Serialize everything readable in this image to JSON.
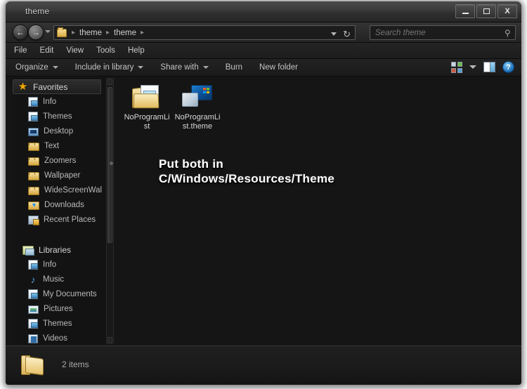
{
  "window": {
    "title": "theme",
    "controls": {
      "minimize": "minimize-button",
      "maximize": "maximize-button",
      "close_label": "X"
    }
  },
  "address_bar": {
    "back_glyph": "←",
    "forward_glyph": "→",
    "crumbs": [
      "theme",
      "theme"
    ],
    "separator": "▸",
    "refresh_glyph": "↻"
  },
  "search": {
    "placeholder": "Search theme",
    "value": "",
    "icon": "search-icon"
  },
  "menu_bar": {
    "items": [
      {
        "label": "File"
      },
      {
        "label": "Edit"
      },
      {
        "label": "View"
      },
      {
        "label": "Tools"
      },
      {
        "label": "Help"
      }
    ]
  },
  "toolbar": {
    "items": [
      {
        "label": "Organize",
        "has_caret": true
      },
      {
        "label": "Include in library",
        "has_caret": true
      },
      {
        "label": "Share with",
        "has_caret": true
      },
      {
        "label": "Burn",
        "has_caret": false
      },
      {
        "label": "New folder",
        "has_caret": false
      }
    ],
    "right_icons": [
      {
        "name": "change-view-icon"
      },
      {
        "name": "view-dropdown-icon"
      },
      {
        "name": "preview-pane-icon"
      },
      {
        "name": "help-icon",
        "glyph": "?"
      }
    ]
  },
  "sidebar": {
    "groups": [
      {
        "header": {
          "label": "Favorites",
          "icon": "star-icon"
        },
        "items": [
          {
            "label": "Info",
            "icon": "document-icon"
          },
          {
            "label": "Themes",
            "icon": "document-icon"
          },
          {
            "label": "Desktop",
            "icon": "desktop-icon"
          },
          {
            "label": "Text",
            "icon": "folder-icon"
          },
          {
            "label": "Zoomers",
            "icon": "folder-icon"
          },
          {
            "label": "Wallpaper",
            "icon": "folder-icon"
          },
          {
            "label": "WideScreenWal",
            "icon": "folder-icon"
          },
          {
            "label": "Downloads",
            "icon": "downloads-icon"
          },
          {
            "label": "Recent Places",
            "icon": "recent-places-icon"
          }
        ]
      },
      {
        "header": {
          "label": "Libraries",
          "icon": "libraries-icon"
        },
        "items": [
          {
            "label": "Info",
            "icon": "document-icon"
          },
          {
            "label": "Music",
            "icon": "music-icon"
          },
          {
            "label": "My Documents",
            "icon": "document-icon"
          },
          {
            "label": "Pictures",
            "icon": "pictures-icon"
          },
          {
            "label": "Themes",
            "icon": "document-icon"
          },
          {
            "label": "Videos",
            "icon": "video-icon"
          }
        ]
      }
    ]
  },
  "content": {
    "files": [
      {
        "name": "NoProgramList",
        "icon": "folder-with-picture-icon"
      },
      {
        "name": "NoProgramList.theme",
        "icon": "theme-file-icon"
      }
    ],
    "annotation_line1": "Put both in",
    "annotation_line2": "C/Windows/Resources/Theme"
  },
  "status_bar": {
    "icon": "folder-icon",
    "text": "2 items"
  }
}
